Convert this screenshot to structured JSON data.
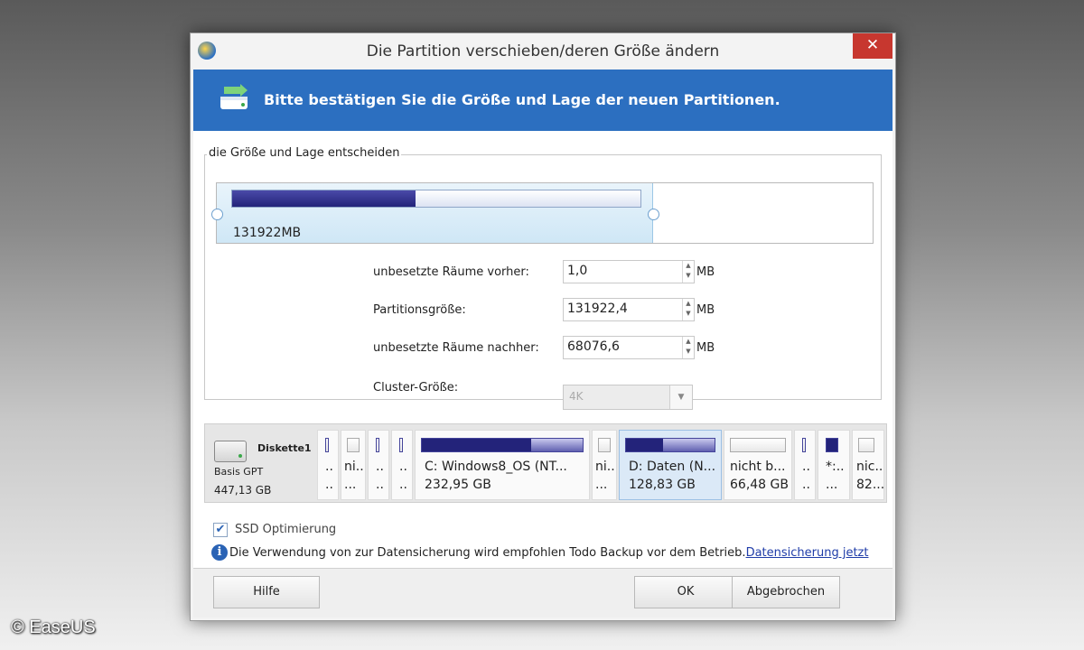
{
  "window": {
    "title": "Die Partition verschieben/deren Größe ändern",
    "close_symbol": "✕",
    "banner_text": "Bitte bestätigen Sie die Größe und Lage der neuen Partitionen."
  },
  "size_group": {
    "legend": "die Größe und Lage entscheiden",
    "partition_size_label": "131922MB",
    "usage_fraction": 0.45
  },
  "fields": {
    "before_label": "unbesetzte Räume vorher:",
    "before_value": "1,0",
    "size_label": "Partitionsgröße:",
    "size_value": "131922,4",
    "after_label": "unbesetzte Räume nachher:",
    "after_value": "68076,6",
    "unit": "MB",
    "cluster_label": "Cluster-Größe:",
    "cluster_value": "4K"
  },
  "disk": {
    "name": "Diskette1",
    "type": "Basis GPT",
    "size": "447,13 GB",
    "partitions": [
      {
        "l1": "..",
        "l2": ".."
      },
      {
        "l1": "ni...",
        "l2": "..."
      },
      {
        "l1": "..",
        "l2": ".."
      },
      {
        "l1": "..",
        "l2": ".."
      },
      {
        "l1": "C: Windows8_OS (NT...",
        "l2": "232,95 GB"
      },
      {
        "l1": "ni...",
        "l2": "..."
      },
      {
        "l1": "D: Daten (N...",
        "l2": "128,83 GB"
      },
      {
        "l1": "nicht b...",
        "l2": "66,48 GB"
      },
      {
        "l1": "..",
        "l2": ".."
      },
      {
        "l1": "*:..",
        "l2": "..."
      },
      {
        "l1": "nic...",
        "l2": "82..."
      }
    ]
  },
  "options": {
    "ssd_label": "SSD Optimierung",
    "ssd_checked": true,
    "info_text": "Die Verwendung von zur Datensicherung wird empfohlen Todo Backup vor dem Betrieb.",
    "info_link": "Datensicherung jetzt"
  },
  "buttons": {
    "help": "Hilfe",
    "ok": "OK",
    "cancel": "Abgebrochen"
  },
  "watermark": "© EaseUS",
  "colors": {
    "banner": "#2c6fc0",
    "close": "#c7372f",
    "bar_fill": "#23237a"
  }
}
